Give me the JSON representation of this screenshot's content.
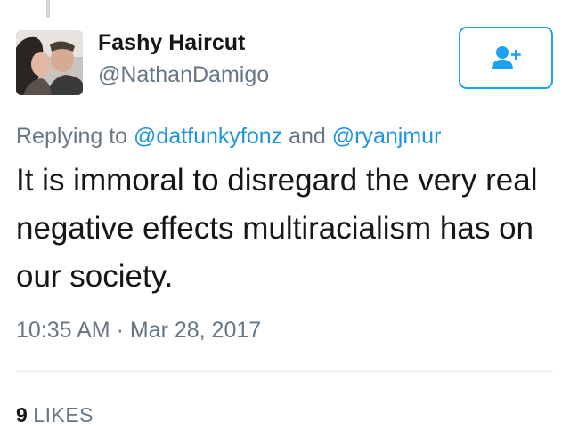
{
  "tweet": {
    "author": {
      "display_name": "Fashy Haircut",
      "handle": "@NathanDamigo"
    },
    "follow_button": {
      "icon": "add-user-icon",
      "accent_color": "#1da1f2"
    },
    "reply_context": {
      "prefix": "Replying to ",
      "mention_1": "@datfunkyfonz",
      "joiner": " and ",
      "mention_2": "@ryanjmur"
    },
    "text": "It is immoral to disregard the very real negative effects multiracialism has on our society.",
    "timestamp": "10:35 AM · Mar 28, 2017",
    "likes": {
      "count": "9",
      "label": "LIKES"
    }
  },
  "colors": {
    "text_primary": "#14171a",
    "text_secondary": "#657786",
    "link": "#1b95e0",
    "divider": "#e1e8ed"
  }
}
